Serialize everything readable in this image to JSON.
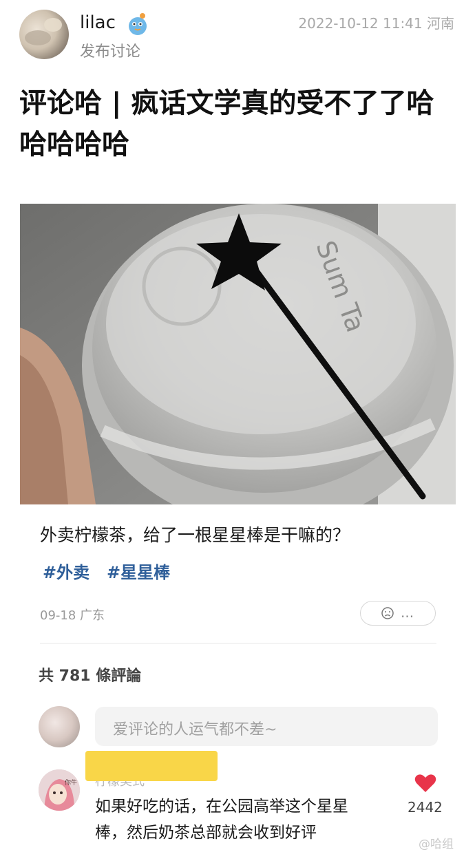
{
  "header": {
    "username": "lilac",
    "action": "发布讨论",
    "meta": "2022-10-12 11:41 河南"
  },
  "post": {
    "title": "评论哈 | 疯话文学真的受不了了哈哈哈哈哈"
  },
  "card": {
    "question": "外卖柠檬茶，给了一根星星棒是干嘛的？",
    "tags": [
      "#外卖",
      "#星星棒"
    ],
    "meta": "09-18 广东",
    "reaction_more": "..."
  },
  "comments": {
    "count_label": "共 781 條評論",
    "input_placeholder": "爱评论的人运气都不差~",
    "items": [
      {
        "author": "柠檬美式",
        "avatar_text": "你牛",
        "text": "如果好吃的话，在公园高举这个星星棒，然后奶茶总部就会收到好评",
        "likes": "2442"
      }
    ]
  },
  "watermark": "@哈组",
  "colors": {
    "tag": "#2f5f9a",
    "heart": "#e8344a",
    "highlight": "#f9d648"
  },
  "icons": [
    "badge-icon",
    "sad-face-icon",
    "heart-icon",
    "weibo-icon"
  ]
}
